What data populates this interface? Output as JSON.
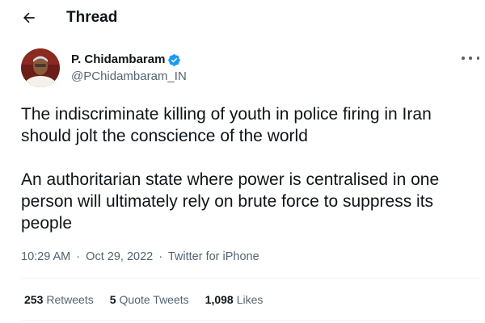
{
  "header": {
    "title": "Thread",
    "back_icon": "arrow-left-icon"
  },
  "tweet": {
    "author": {
      "name": "P. Chidambaram",
      "handle": "@PChidambaram_IN",
      "verified_icon": "verified-badge-icon",
      "verified_color": "#1d9bf0"
    },
    "paragraphs": [
      "The indiscriminate killing of youth in police firing in Iran should jolt the conscience of the world",
      "An authoritarian state where power is centralised in one person will ultimately rely on brute force to suppress its people"
    ],
    "meta": {
      "time": "10:29 AM",
      "separator": "·",
      "date": "Oct 29, 2022",
      "source": "Twitter for iPhone"
    },
    "stats": {
      "retweets_count": "253",
      "retweets_label": "Retweets",
      "quotes_count": "5",
      "quotes_label": "Quote Tweets",
      "likes_count": "1,098",
      "likes_label": "Likes"
    },
    "more_icon": "more-options-icon"
  },
  "colors": {
    "text": "#0f1419",
    "secondary_text": "#536471",
    "divider": "#eff3f4",
    "accent": "#1d9bf0"
  }
}
